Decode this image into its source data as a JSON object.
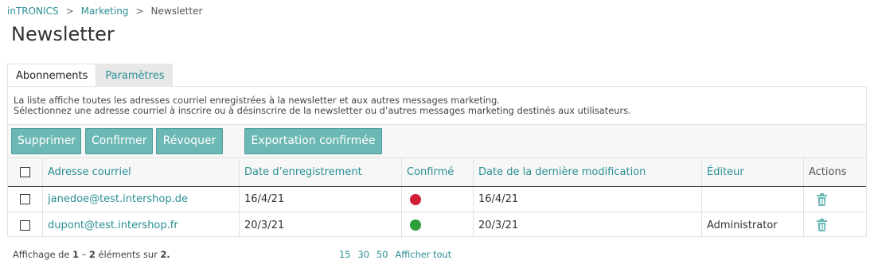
{
  "breadcrumb": {
    "items": [
      "inTRONICS",
      "Marketing"
    ],
    "separator": ">",
    "current": "Newsletter"
  },
  "page": {
    "title": "Newsletter"
  },
  "tabs": [
    {
      "label": "Abonnements",
      "active": true
    },
    {
      "label": "Paramètres",
      "active": false
    }
  ],
  "info": {
    "line1": "La liste affiche toutes les adresses courriel enregistrées à la newsletter et aux autres messages marketing.",
    "line2": "Sélectionnez une adresse courriel à inscrire ou à désinscrire de la newsletter ou d’autres messages marketing destinés aux utilisateurs."
  },
  "toolbar": {
    "delete": "Supprimer",
    "confirm": "Confirmer",
    "revoke": "Révoquer",
    "export": "Exportation confirmée"
  },
  "table": {
    "headers": {
      "email": "Adresse courriel",
      "registered": "Date d’enregistrement",
      "confirmed": "Confirmé",
      "modified": "Date de la dernière modification",
      "editor": "Éditeur",
      "actions": "Actions"
    },
    "rows": [
      {
        "email": "janedoe@test.intershop.de",
        "registered": "16/4/21",
        "confirmed": false,
        "modified": "16/4/21",
        "editor": ""
      },
      {
        "email": "dupont@test.intershop.fr",
        "registered": "20/3/21",
        "confirmed": true,
        "modified": "20/3/21",
        "editor": "Administrator"
      }
    ]
  },
  "footer": {
    "prefix": "Affichage de",
    "from": "1",
    "dash": "–",
    "to": "2",
    "middle": "éléments sur",
    "total": "2.",
    "page_sizes": [
      "15",
      "30",
      "50"
    ],
    "show_all": "Afficher tout"
  },
  "colors": {
    "accent": "#2a8f94",
    "button": "#6cb8b5",
    "status_unconfirmed": "#d11f3a",
    "status_confirmed": "#2e9e3a"
  },
  "icons": {
    "row_action": "trash-icon",
    "status": "status-dot-icon"
  }
}
